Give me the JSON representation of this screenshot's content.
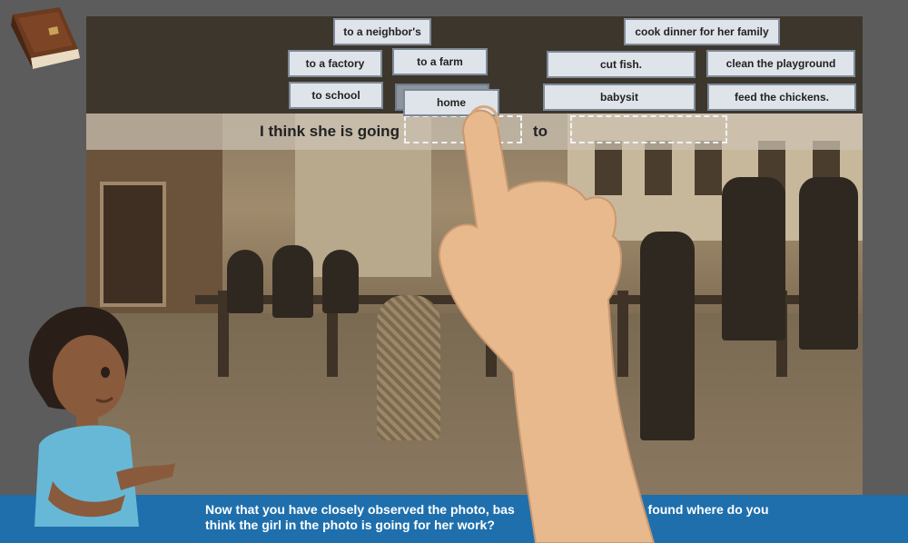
{
  "sentence": {
    "prefix": "I think she is going",
    "middle": "to"
  },
  "destinations": [
    "to a neighbor's",
    "to a factory",
    "to a farm",
    "to school",
    "home"
  ],
  "tasks": [
    "cook dinner for her family",
    "cut fish.",
    "clean the playground",
    "babysit",
    "feed the chickens."
  ],
  "question": {
    "line1_a": "Now that you have closely observed the photo, bas",
    "line1_b": "you found where do you",
    "line2": "think the girl in the photo is going for her work?"
  },
  "icons": {
    "journal": "book-icon"
  },
  "colors": {
    "question_bar": "#1f6fad",
    "chip_bg": "#dfe4ea",
    "panel_dark": "#3d362d"
  }
}
